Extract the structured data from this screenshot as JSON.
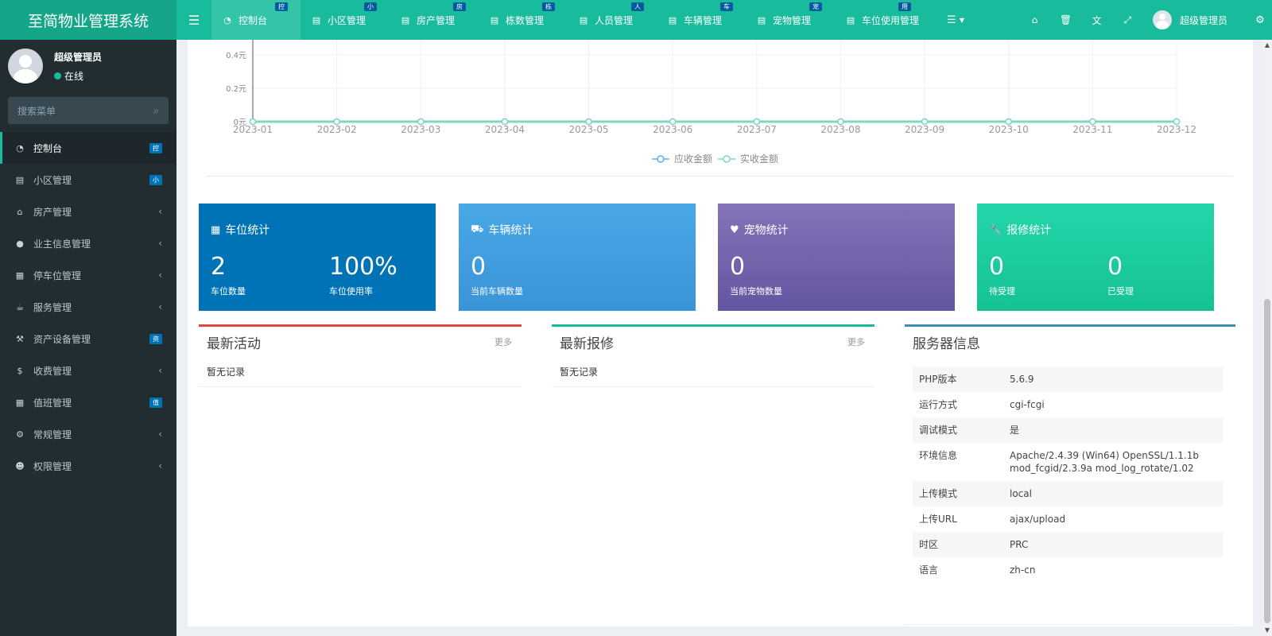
{
  "app": {
    "title": "至简物业管理系统"
  },
  "topnav": {
    "tabs": [
      {
        "label": "控制台",
        "badge": "控",
        "icon": "dashboard-icon",
        "active": true
      },
      {
        "label": "小区管理",
        "badge": "小",
        "icon": "list-icon"
      },
      {
        "label": "房产管理",
        "badge": "房",
        "icon": "list-icon"
      },
      {
        "label": "栋数管理",
        "badge": "栋",
        "icon": "list-icon"
      },
      {
        "label": "人员管理",
        "badge": "人",
        "icon": "list-icon"
      },
      {
        "label": "车辆管理",
        "badge": "车",
        "icon": "list-icon"
      },
      {
        "label": "宠物管理",
        "badge": "宠",
        "icon": "list-icon"
      },
      {
        "label": "车位使用管理",
        "badge": "用",
        "icon": "list-icon"
      }
    ],
    "user_name": "超级管理员"
  },
  "sidebar": {
    "user_name": "超级管理员",
    "status": "在线",
    "search_placeholder": "搜索菜单",
    "items": [
      {
        "label": "控制台",
        "badge": "控",
        "icon": "dashboard-icon",
        "active": true
      },
      {
        "label": "小区管理",
        "badge": "小",
        "icon": "list-icon"
      },
      {
        "label": "房产管理",
        "icon": "home-icon",
        "chevron": true
      },
      {
        "label": "业主信息管理",
        "icon": "user-icon",
        "chevron": true
      },
      {
        "label": "停车位管理",
        "icon": "film-icon",
        "chevron": true
      },
      {
        "label": "服务管理",
        "icon": "coffee-icon",
        "chevron": true
      },
      {
        "label": "资产设备管理",
        "badge": "资",
        "icon": "gavel-icon"
      },
      {
        "label": "收费管理",
        "icon": "dollar-icon",
        "chevron": true
      },
      {
        "label": "值班管理",
        "badge": "值",
        "icon": "calendar-icon"
      },
      {
        "label": "常规管理",
        "icon": "cogs-icon",
        "chevron": true
      },
      {
        "label": "权限管理",
        "icon": "group-icon",
        "chevron": true
      }
    ]
  },
  "chart_data": {
    "type": "line",
    "x": [
      "2023-01",
      "2023-02",
      "2023-03",
      "2023-04",
      "2023-05",
      "2023-06",
      "2023-07",
      "2023-08",
      "2023-09",
      "2023-10",
      "2023-11",
      "2023-12"
    ],
    "y_tick_labels": [
      "0元",
      "0.2元",
      "0.4元"
    ],
    "series": [
      {
        "name": "应收金额",
        "values": [
          0,
          0,
          0,
          0,
          0,
          0,
          0,
          0,
          0,
          0,
          0,
          0
        ],
        "color": "#5ab1ef"
      },
      {
        "name": "实收金额",
        "values": [
          0,
          0,
          0,
          0,
          0,
          0,
          0,
          0,
          0,
          0,
          0,
          0
        ],
        "color": "#7dd8c1"
      }
    ],
    "legend": "bottom-center",
    "grid": true
  },
  "stats": [
    {
      "title": "车位统计",
      "icon": "film-icon",
      "color": "#0073b7",
      "items": [
        {
          "value": "2",
          "label": "车位数量"
        },
        {
          "value": "100%",
          "label": "车位使用率"
        }
      ]
    },
    {
      "title": "车辆统计",
      "icon": "truck-icon",
      "color": "#43a0e3",
      "items": [
        {
          "value": "0",
          "label": "当前车辆数量"
        }
      ]
    },
    {
      "title": "宠物统计",
      "icon": "heart-icon",
      "color": "#7360a8",
      "items": [
        {
          "value": "0",
          "label": "当前宠物数量"
        }
      ]
    },
    {
      "title": "报修统计",
      "icon": "wrench-icon",
      "color": "#1bcb9c",
      "items": [
        {
          "value": "0",
          "label": "待受理"
        },
        {
          "value": "0",
          "label": "已受理"
        }
      ]
    }
  ],
  "panels": {
    "activity": {
      "title": "最新活动",
      "more": "更多",
      "empty": "暂无记录",
      "color": "#dd4b39"
    },
    "repair": {
      "title": "最新报修",
      "more": "更多",
      "empty": "暂无记录",
      "color": "#18bc9c"
    },
    "server": {
      "title": "服务器信息",
      "color": "#3c8dbc",
      "rows": [
        {
          "k": "PHP版本",
          "v": "5.6.9"
        },
        {
          "k": "运行方式",
          "v": "cgi-fcgi"
        },
        {
          "k": "调试模式",
          "v": "是"
        },
        {
          "k": "环境信息",
          "v": "Apache/2.4.39 (Win64) OpenSSL/1.1.1b mod_fcgid/2.3.9a mod_log_rotate/1.02"
        },
        {
          "k": "上传模式",
          "v": "local"
        },
        {
          "k": "上传URL",
          "v": "ajax/upload"
        },
        {
          "k": "时区",
          "v": "PRC"
        },
        {
          "k": "语言",
          "v": "zh-cn"
        }
      ]
    }
  }
}
